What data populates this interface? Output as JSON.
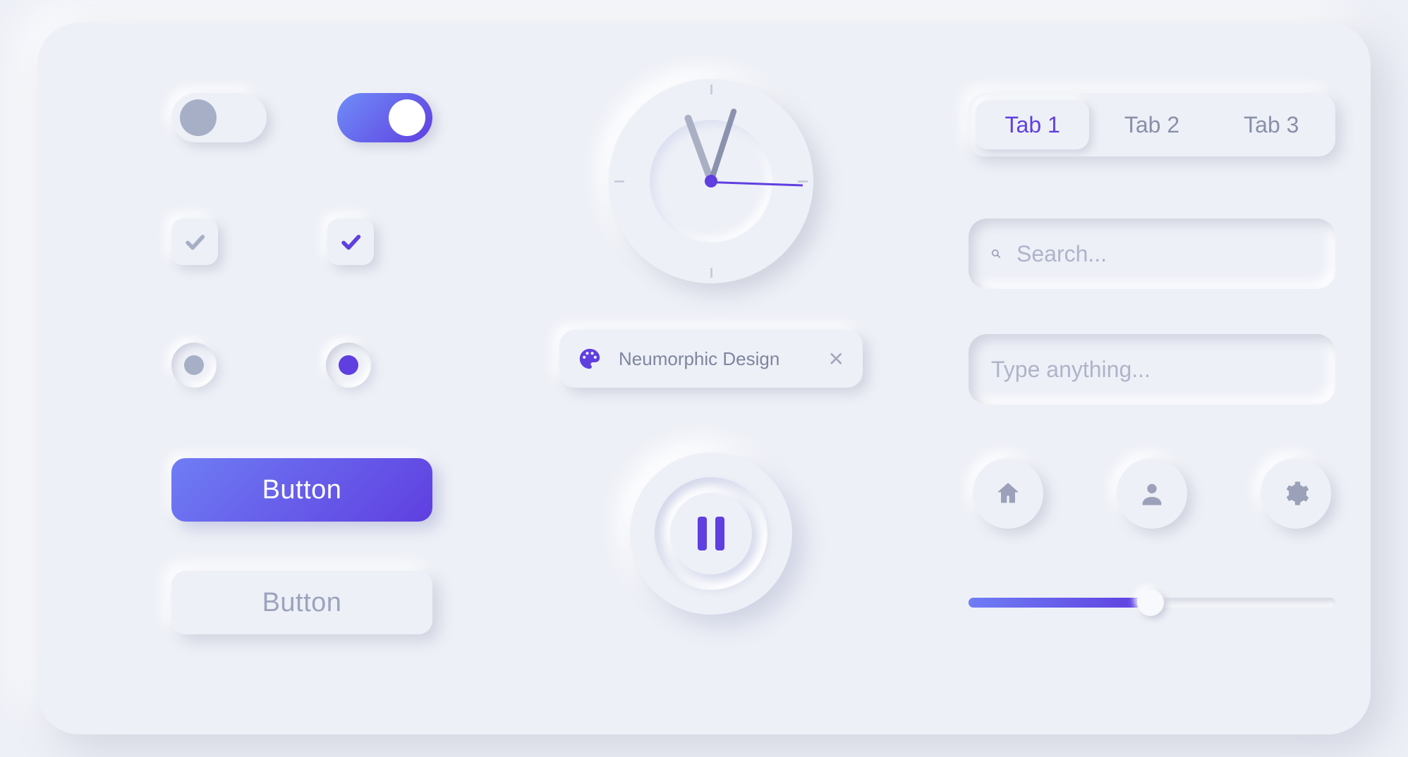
{
  "toggles": {
    "off": false,
    "on": true
  },
  "checkboxes": {
    "unchecked_style": "grey",
    "checked_style": "blue"
  },
  "radios": {
    "unselected": "grey",
    "selected": "blue"
  },
  "buttons": {
    "primary_label": "Button",
    "neutral_label": "Button"
  },
  "chip": {
    "label": "Neumorphic Design",
    "close": "✕"
  },
  "tabs": {
    "items": [
      "Tab 1",
      "Tab 2",
      "Tab 3"
    ],
    "active_index": 0
  },
  "inputs": {
    "search_placeholder": "Search...",
    "text_placeholder": "Type anything..."
  },
  "icon_buttons": [
    "home",
    "user",
    "gear"
  ],
  "slider": {
    "value": 48,
    "min": 0,
    "max": 100
  },
  "clock": {
    "hour_hand_deg": -20,
    "minute_hand_deg": 18,
    "second_hand_deg": 2
  },
  "media": {
    "state": "pause"
  },
  "colors": {
    "accent": "#5f3fe0",
    "accent2": "#6f7df4",
    "muted": "#a7afc7",
    "bg": "#eef0f7"
  }
}
